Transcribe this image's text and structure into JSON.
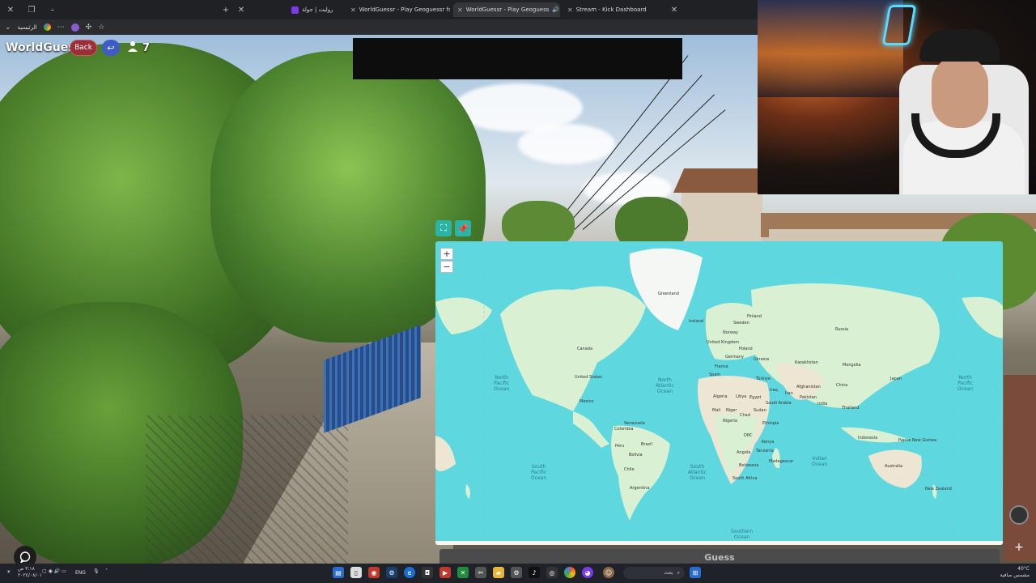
{
  "browser": {
    "tabs": [
      {
        "label": "روليت | جولة",
        "active": false
      },
      {
        "label": "WorldGuessr - Play Geoguessr for",
        "active": false
      },
      {
        "label": "WorldGuessr - Play Geoguess",
        "active": true
      },
      {
        "label": "Stream - Kick Dashboard",
        "active": false
      }
    ],
    "new_tab": "+",
    "bookmark_label": "الرئيسية"
  },
  "game": {
    "logo": "WorldGuessr",
    "back_label": "Back",
    "undo_icon": "↩",
    "player_count": "7",
    "guess_label": "Guess",
    "zoom_in": "+",
    "zoom_out": "−"
  },
  "map": {
    "countries": [
      "Greenland",
      "Iceland",
      "Norway",
      "Sweden",
      "Finland",
      "Russia",
      "United Kingdom",
      "Poland",
      "Germany",
      "France",
      "Spain",
      "Ukraine",
      "Kazakhstan",
      "Mongolia",
      "China",
      "Japan",
      "Türkiye",
      "Iraq",
      "Iran",
      "Afghanistan",
      "Pakistan",
      "India",
      "Thailand",
      "Saudi Arabia",
      "Egypt",
      "Algeria",
      "Libya",
      "Mali",
      "Niger",
      "Chad",
      "Sudan",
      "Nigeria",
      "Ethiopia",
      "DRC",
      "Kenya",
      "Tanzania",
      "Angola",
      "Botswana",
      "South Africa",
      "Madagascar",
      "Indonesia",
      "Papua New Guinea",
      "Australia",
      "New Zealand",
      "Canada",
      "United States",
      "Mexico",
      "Venezuela",
      "Colombia",
      "Brazil",
      "Peru",
      "Bolivia",
      "Chile",
      "Argentina"
    ],
    "oceans": [
      "North\nPacific\nOcean",
      "North\nAtlantic\nOcean",
      "South\nPacific\nOcean",
      "South\nAtlantic\nOcean",
      "Indian\nOcean",
      "Southern\nOcean",
      "North\nPacific\nOcean"
    ]
  },
  "taskbar": {
    "lang": "ENG",
    "search_placeholder": "بحث",
    "time": "٣:١٨ ص",
    "date": "٢٠٢٤/٠٨/٠١",
    "weather_temp": "40°C",
    "weather_desc": "مشمس صافية"
  },
  "colors": {
    "ocean": "#5fd7df",
    "land": "#d9f0d3",
    "land_dry": "#ece6d3",
    "back_button": "#9b2f37",
    "undo_button": "#3e5bc9",
    "map_tool": "#2bb3a6"
  }
}
